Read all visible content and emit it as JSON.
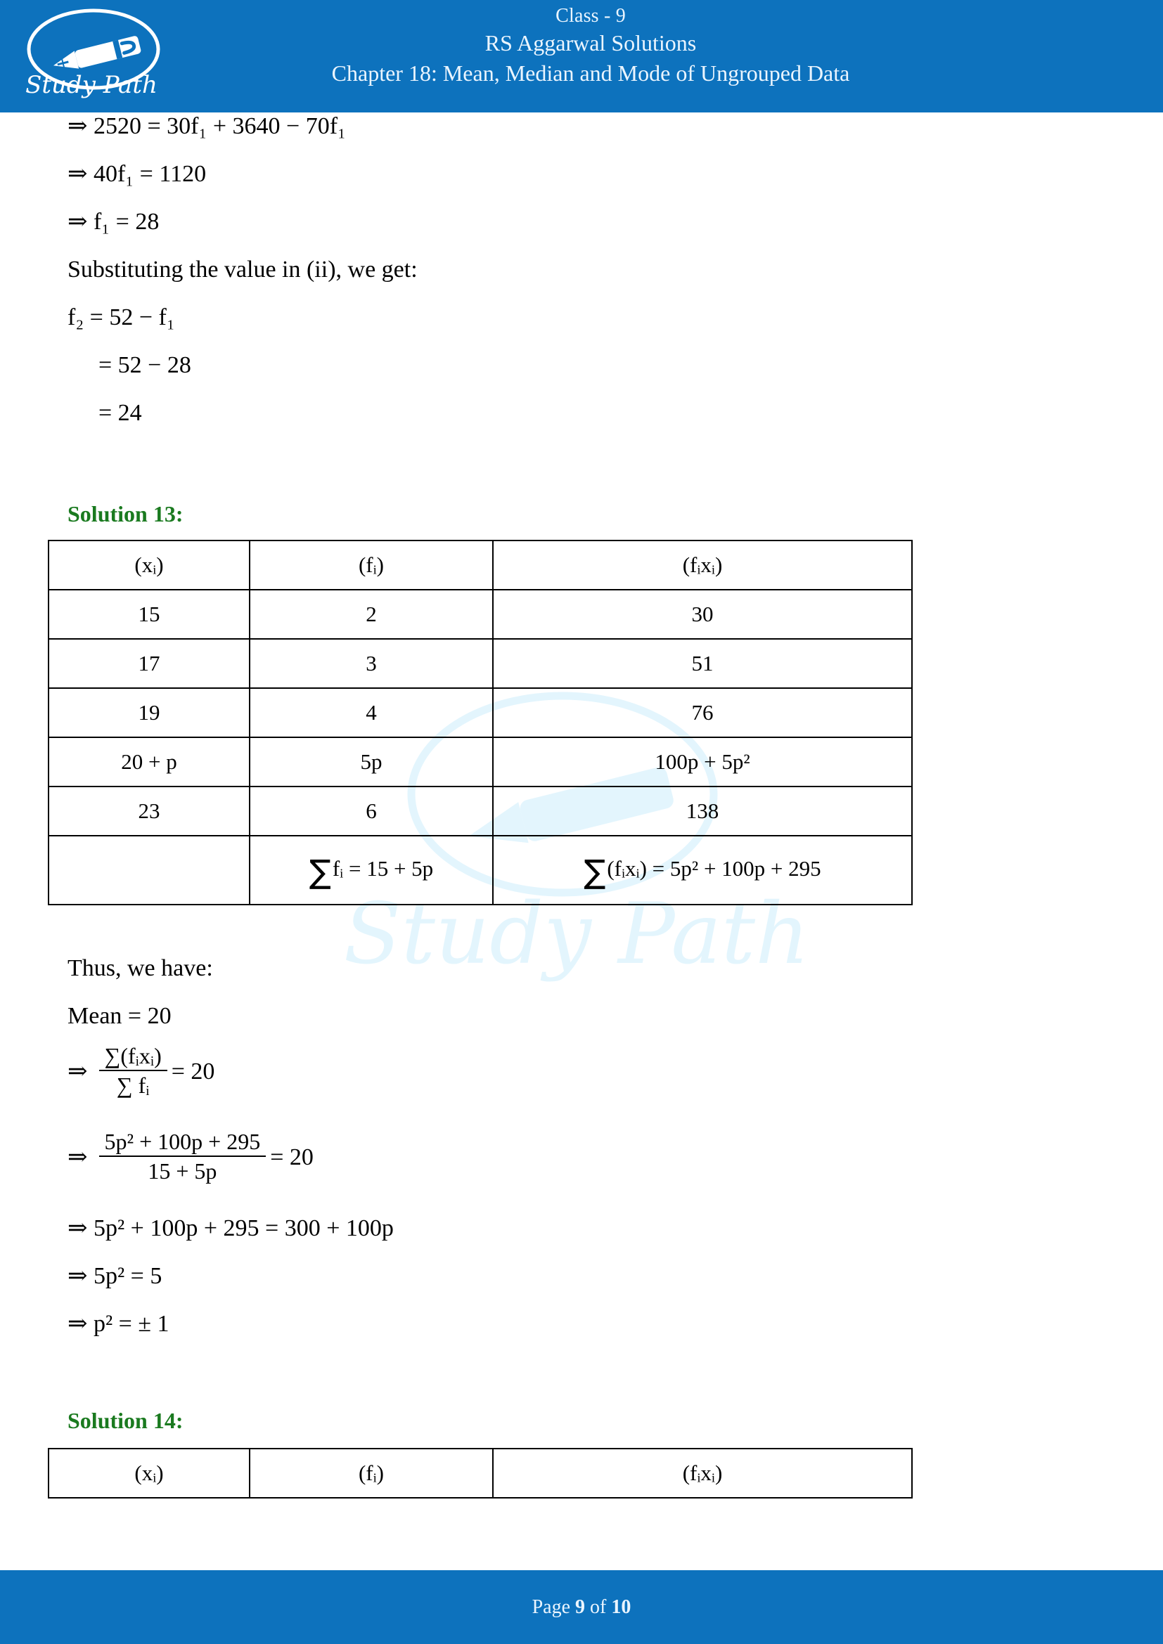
{
  "header": {
    "class_line": "Class - 9",
    "book_line": "RS Aggarwal Solutions",
    "chapter_line": "Chapter 18: Mean, Median and Mode of Ungrouped Data",
    "logo_text": "Study Path",
    "brand_color": "#0d72bd",
    "title_color": "#eaf5ff"
  },
  "watermark": {
    "text": "Study Path",
    "color": "#e3f5fd"
  },
  "body": {
    "heading_color": "#1a7a1f",
    "pre_lines": [
      {
        "id": "l1",
        "text": "⇒ 2520 = 30f₁ + 3640 − 70f₁"
      },
      {
        "id": "l2",
        "text": "⇒ 40f₁ = 1120"
      },
      {
        "id": "l3",
        "text": "⇒ f₁ = 28"
      },
      {
        "id": "l4",
        "text": "Substituting the value in (ii), we get:"
      },
      {
        "id": "l5",
        "text": "f₂ = 52 − f₁"
      },
      {
        "id": "l6",
        "text": "= 52 − 28"
      },
      {
        "id": "l7",
        "text": "= 24"
      }
    ],
    "solution13": {
      "heading": "Solution 13:",
      "table": {
        "headers": [
          "(xᵢ)",
          "(fᵢ)",
          "(fᵢxᵢ)"
        ],
        "rows": [
          [
            "15",
            "2",
            "30"
          ],
          [
            "17",
            "3",
            "51"
          ],
          [
            "19",
            "4",
            "76"
          ],
          [
            "20 + p",
            "5p",
            "100p + 5p²"
          ],
          [
            "23",
            "6",
            "138"
          ]
        ],
        "sum_row": {
          "x": "",
          "f": "∑ fᵢ = 15 + 5p",
          "fx": "∑ (fᵢxᵢ) = 5p² + 100p + 295",
          "f_sigma": "∑",
          "f_body": "fᵢ = 15 + 5p",
          "fx_sigma": "∑",
          "fx_body": "(fᵢxᵢ) = 5p² + 100p + 295"
        }
      },
      "after_lines": [
        {
          "id": "a1",
          "text": "Thus, we have:"
        },
        {
          "id": "a2",
          "text": "Mean = 20"
        }
      ],
      "eq_frac1": {
        "arrow": "⇒",
        "numerator": "∑(fᵢxᵢ)",
        "denominator": "∑ fᵢ",
        "rhs": "= 20"
      },
      "eq_frac2": {
        "arrow": "⇒",
        "numerator": "5p² + 100p + 295",
        "denominator": "15 + 5p",
        "rhs": "= 20"
      },
      "final_lines": [
        {
          "id": "f1",
          "text": "⇒ 5p² + 100p + 295 = 300 + 100p"
        },
        {
          "id": "f2",
          "text": "⇒ 5p² = 5"
        },
        {
          "id": "f3",
          "text": "⇒ p² = ± 1"
        }
      ]
    },
    "solution14": {
      "heading": "Solution 14:",
      "table": {
        "headers": [
          "(xᵢ)",
          "(fᵢ)",
          "(fᵢxᵢ)"
        ],
        "rows": []
      }
    }
  },
  "footer": {
    "label": "Page",
    "current_page": "9",
    "of_label": "of",
    "total_pages": "10"
  }
}
